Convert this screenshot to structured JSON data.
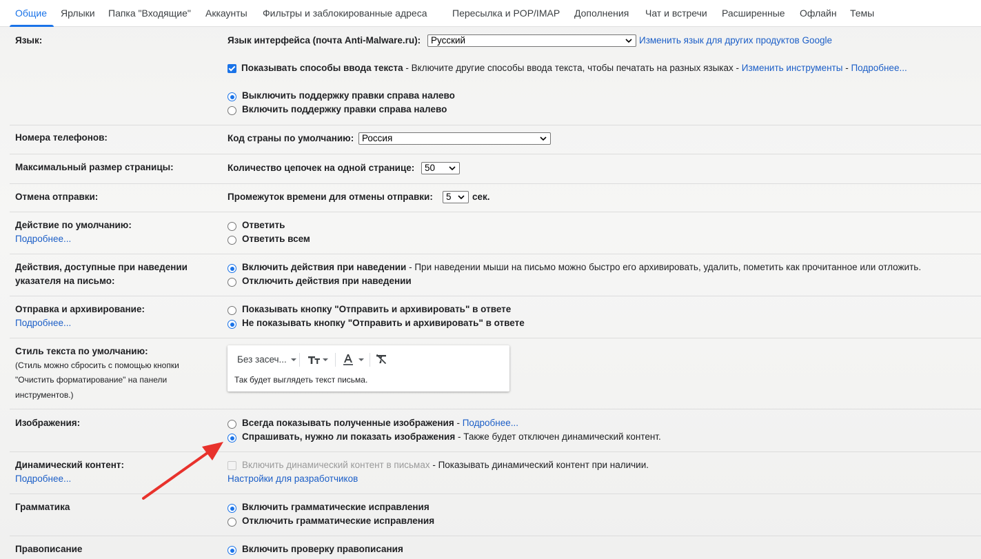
{
  "tabs": [
    "Общие",
    "Ярлыки",
    "Папка \"Входящие\"",
    "Аккаунты",
    "Фильтры и заблокированные адреса",
    "Пересылка и POP/IMAP",
    "Дополнения",
    "Чат и встречи",
    "Расширенные",
    "Офлайн",
    "Темы"
  ],
  "language": {
    "label": "Язык:",
    "ui_lang_label": "Язык интерфейса (почта Anti-Malware.ru):",
    "ui_lang_value": "Русский",
    "change_other": "Изменить язык для других продуктов Google",
    "input_tools_label": "Показывать способы ввода текста",
    "input_tools_desc": " - Включите другие способы ввода текста, чтобы печатать на разных языках - ",
    "input_tools_link": "Изменить инструменты",
    "dash": " - ",
    "more": "Подробнее...",
    "rtl_off": "Выключить поддержку правки справа налево",
    "rtl_on": "Включить поддержку правки справа налево"
  },
  "phone": {
    "label": "Номера телефонов:",
    "country_label": "Код страны по умолчанию:",
    "country_value": "Россия"
  },
  "page_size": {
    "label": "Максимальный размер страницы:",
    "threads_label": "Количество цепочек на одной странице:",
    "threads_value": "50"
  },
  "undo_send": {
    "label": "Отмена отправки:",
    "period_label": "Промежуток времени для отмены отправки:",
    "period_value": "5",
    "unit": "сек."
  },
  "default_action": {
    "label": "Действие по умолчанию:",
    "more": "Подробнее...",
    "reply": "Ответить",
    "reply_all": "Ответить всем"
  },
  "hover": {
    "label_line1": "Действия, доступные при наведении",
    "label_line2": "указателя на письмо:",
    "enable": "Включить действия при наведении",
    "enable_desc": " - При наведении мыши на письмо можно быстро его архивировать, удалить, пометить как прочитанное или отложить.",
    "disable": "Отключить действия при наведении"
  },
  "send_archive": {
    "label": "Отправка и архивирование:",
    "more": "Подробнее...",
    "show": "Показывать кнопку \"Отправить и архивировать\" в ответе",
    "hide": "Не показывать кнопку \"Отправить и архивировать\" в ответе"
  },
  "text_style": {
    "label": "Стиль текста по умолчанию:",
    "note1": "(Стиль можно сбросить с помощью кнопки",
    "note2": "\"Очистить форматирование\" на панели",
    "note3": "инструментов.)",
    "font": "Без засеч...",
    "sample": "Так будет выглядеть текст письма."
  },
  "images": {
    "label": "Изображения:",
    "always": "Всегда показывать полученные изображения",
    "dash": " - ",
    "more": "Подробнее...",
    "ask": "Спрашивать, нужно ли показать изображения",
    "ask_desc": " - Также будет отключен динамический контент."
  },
  "dynamic": {
    "label": "Динамический контент:",
    "more": "Подробнее...",
    "enable": "Включить динамический контент в письмах",
    "enable_desc": " - Показывать динамический контент при наличии.",
    "dev": "Настройки для разработчиков"
  },
  "grammar": {
    "label": "Грамматика",
    "enable": "Включить грамматические исправления",
    "disable": "Отключить грамматические исправления"
  },
  "spelling": {
    "label": "Правописание",
    "enable": "Включить проверку правописания"
  },
  "colors": {
    "accent": "#1a73e8",
    "link": "#1b5ec7",
    "annotation_arrow": "#e8322c"
  }
}
